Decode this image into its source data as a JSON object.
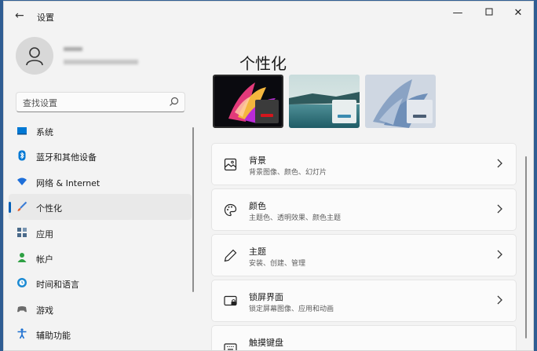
{
  "window": {
    "title": "设置"
  },
  "search": {
    "placeholder": "查找设置"
  },
  "nav": [
    {
      "label": "系统",
      "icon": "monitor-icon",
      "color": "#0078d4"
    },
    {
      "label": "蓝牙和其他设备",
      "icon": "bluetooth-icon",
      "color": "#0078d4"
    },
    {
      "label": "网络 & Internet",
      "icon": "wifi-icon",
      "color": "#1e6fd9"
    },
    {
      "label": "个性化",
      "icon": "brush-icon",
      "color": "#e35d2a",
      "active": true
    },
    {
      "label": "应用",
      "icon": "apps-icon",
      "color": "#4a6a8a"
    },
    {
      "label": "帐户",
      "icon": "person-icon",
      "color": "#2ea043"
    },
    {
      "label": "时间和语言",
      "icon": "globe-clock-icon",
      "color": "#1b8ad3"
    },
    {
      "label": "游戏",
      "icon": "gamepad-icon",
      "color": "#6b6b6b"
    },
    {
      "label": "辅助功能",
      "icon": "accessibility-icon",
      "color": "#1b6fd1"
    }
  ],
  "main": {
    "title": "个性化",
    "cards": [
      {
        "title": "背景",
        "subtitle": "背景图像、颜色、幻灯片",
        "icon": "image-icon"
      },
      {
        "title": "颜色",
        "subtitle": "主题色、透明效果、颜色主题",
        "icon": "palette-icon"
      },
      {
        "title": "主题",
        "subtitle": "安装、创建、管理",
        "icon": "pen-icon"
      },
      {
        "title": "锁屏界面",
        "subtitle": "锁定屏幕图像、应用和动画",
        "icon": "lock-screen-icon"
      },
      {
        "title": "触摸键盘",
        "subtitle": "",
        "icon": "keyboard-icon"
      }
    ]
  },
  "colors": {
    "accent": "#005fb8"
  }
}
